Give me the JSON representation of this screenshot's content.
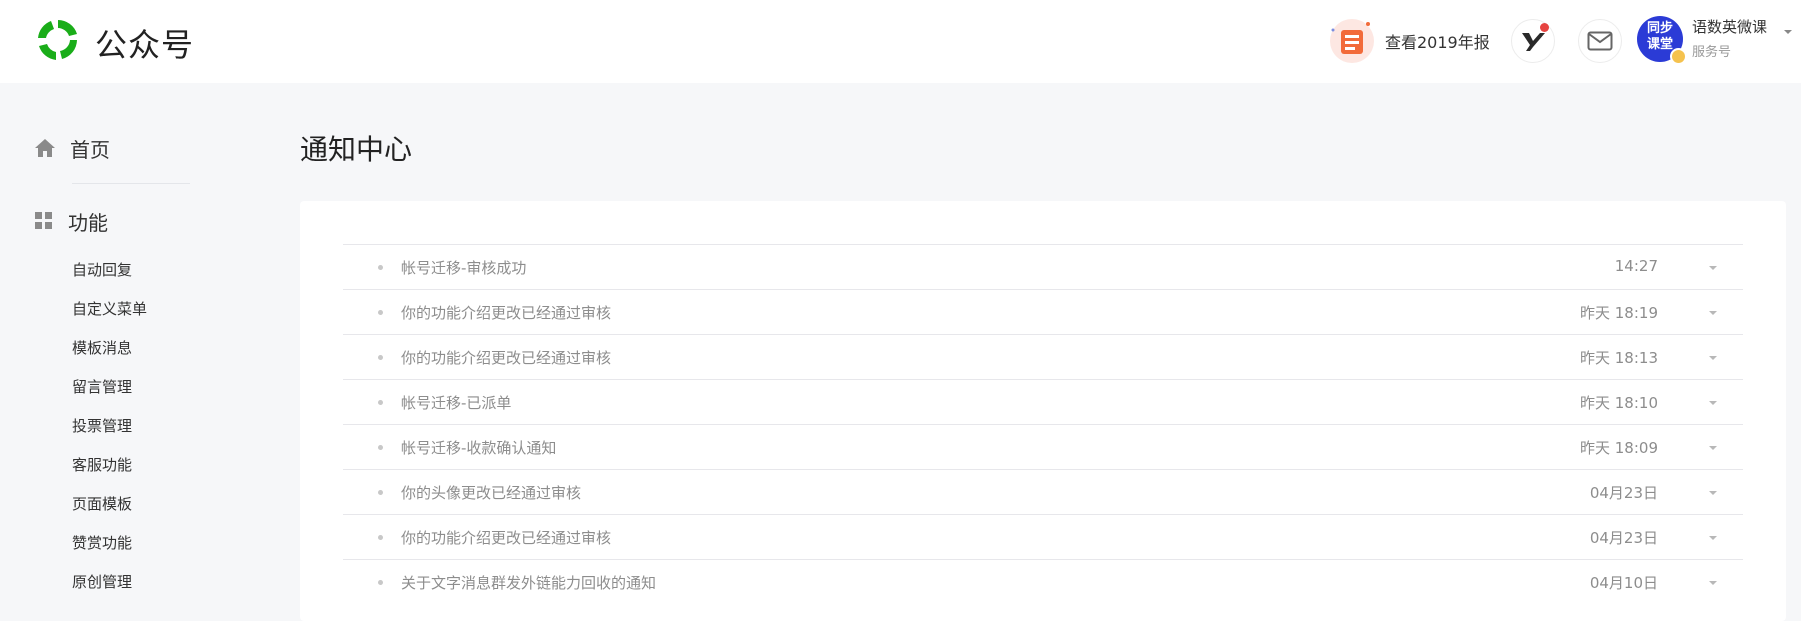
{
  "header": {
    "brand": "公众号",
    "report_label": "查看2019年报",
    "account": {
      "name": "语数英微课",
      "type": "服务号",
      "avatar_text_1": "同步",
      "avatar_text_2": "课堂"
    }
  },
  "sidebar": {
    "home_label": "首页",
    "function_label": "功能",
    "items": [
      {
        "label": "自动回复"
      },
      {
        "label": "自定义菜单"
      },
      {
        "label": "模板消息"
      },
      {
        "label": "留言管理"
      },
      {
        "label": "投票管理"
      },
      {
        "label": "客服功能"
      },
      {
        "label": "页面模板"
      },
      {
        "label": "赞赏功能"
      },
      {
        "label": "原创管理"
      }
    ]
  },
  "main": {
    "title": "通知中心",
    "notifications": [
      {
        "text": "帐号迁移-审核成功",
        "time": "14:27"
      },
      {
        "text": "你的功能介绍更改已经通过审核",
        "time": "昨天 18:19"
      },
      {
        "text": "你的功能介绍更改已经通过审核",
        "time": "昨天 18:13"
      },
      {
        "text": "帐号迁移-已派单",
        "time": "昨天 18:10"
      },
      {
        "text": "帐号迁移-收款确认通知",
        "time": "昨天 18:09"
      },
      {
        "text": "你的头像更改已经通过审核",
        "time": "04月23日"
      },
      {
        "text": "你的功能介绍更改已经通过审核",
        "time": "04月23日"
      },
      {
        "text": "关于文字消息群发外链能力回收的通知",
        "time": "04月10日"
      }
    ]
  },
  "colors": {
    "brand_green": "#1aad19",
    "avatar_blue": "#2b3bd6",
    "dot_red": "#e64340"
  }
}
